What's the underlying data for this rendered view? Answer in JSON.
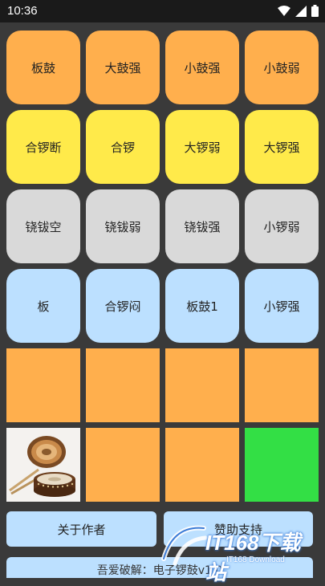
{
  "status": {
    "time": "10:36"
  },
  "pads": [
    {
      "label": "板鼓",
      "color": "orange"
    },
    {
      "label": "大鼓强",
      "color": "orange"
    },
    {
      "label": "小鼓强",
      "color": "orange"
    },
    {
      "label": "小鼓弱",
      "color": "orange"
    },
    {
      "label": "合锣断",
      "color": "yellow"
    },
    {
      "label": "合锣",
      "color": "yellow"
    },
    {
      "label": "大锣弱",
      "color": "yellow"
    },
    {
      "label": "大锣强",
      "color": "yellow"
    },
    {
      "label": "铙钹空",
      "color": "gray"
    },
    {
      "label": "铙钹弱",
      "color": "gray"
    },
    {
      "label": "铙钹强",
      "color": "gray"
    },
    {
      "label": "小锣弱",
      "color": "gray"
    },
    {
      "label": "板",
      "color": "blue"
    },
    {
      "label": "合锣闷",
      "color": "blue"
    },
    {
      "label": "板鼓1",
      "color": "blue"
    },
    {
      "label": "小锣强",
      "color": "blue"
    }
  ],
  "buttons": {
    "about_author": "关于作者",
    "support": "赞助支持"
  },
  "footer": {
    "text": "吾爱破解：电子锣鼓v1.0"
  },
  "watermark": {
    "brand": "IT168下载站",
    "sub": "IT168 Download"
  },
  "colors": {
    "orange": "#FFAF4D",
    "yellow": "#FFEA4A",
    "gray": "#D9D9D9",
    "blue": "#BCE0FF",
    "green": "#33DF45",
    "background": "#3A3A3A"
  }
}
